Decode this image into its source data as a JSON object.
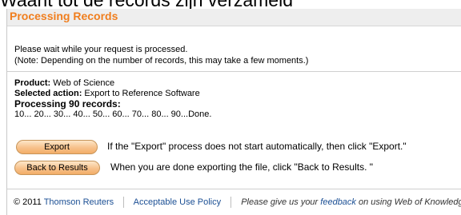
{
  "slide_title": "Waarit tot de records zijn verzameld",
  "header": {
    "title": "Processing Records"
  },
  "wait": {
    "line1": "Please wait while your request is processed.",
    "line2": "(Note: Depending on the number of records, this may take a few moments.)"
  },
  "details": {
    "product_label": "Product:",
    "product_value": "Web of Science",
    "action_label": "Selected action:",
    "action_value": "Export to Reference Software",
    "processing": "Processing 90 records:",
    "progress": "10... 20... 30... 40... 50... 60... 70... 80... 90...Done."
  },
  "buttons": {
    "export_label": "Export",
    "export_text": "If the \"Export\" process does not start automatically, then click \"Export.\"",
    "back_label": "Back to Results",
    "back_text": "When you are done exporting the file, click \"Back to Results. \""
  },
  "footer": {
    "copyright": "© 2011",
    "company": "Thomson Reuters",
    "policy": "Acceptable Use Policy",
    "feedback_prefix": "Please give us your",
    "feedback_link": "feedback",
    "feedback_suffix": "on using Web of Knowledge."
  },
  "colors": {
    "accent": "#f07e1e",
    "link": "#1b4f94"
  }
}
